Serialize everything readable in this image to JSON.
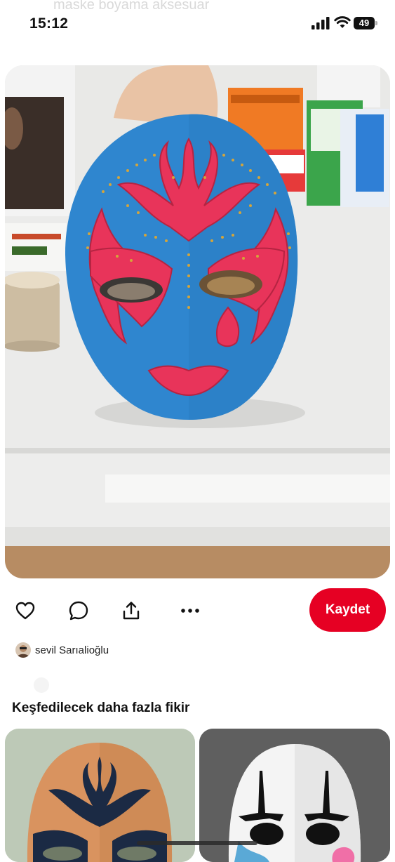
{
  "status_bar": {
    "time": "15:12",
    "battery_level": "49",
    "ghost_title": "maske boyama aksesuar"
  },
  "pin": {
    "image_alt": "blue painted mask with red flame pattern and gold dots"
  },
  "actions": {
    "save_label": "Kaydet",
    "icons": [
      "heart-icon",
      "comment-icon",
      "share-icon",
      "more-icon"
    ]
  },
  "author": {
    "name": "sevil Sarıalioğlu"
  },
  "more_ideas": {
    "title": "Keşfedilecek daha fazla fikir",
    "cards": [
      {
        "alt": "gold painted mask with black flame pattern"
      },
      {
        "alt": "white clown mask with black eye marks"
      }
    ]
  },
  "colors": {
    "accent": "#e60023",
    "mask_blue": "#2f86cf",
    "mask_red": "#e8345a",
    "gold_dots": "#d4a53a"
  }
}
